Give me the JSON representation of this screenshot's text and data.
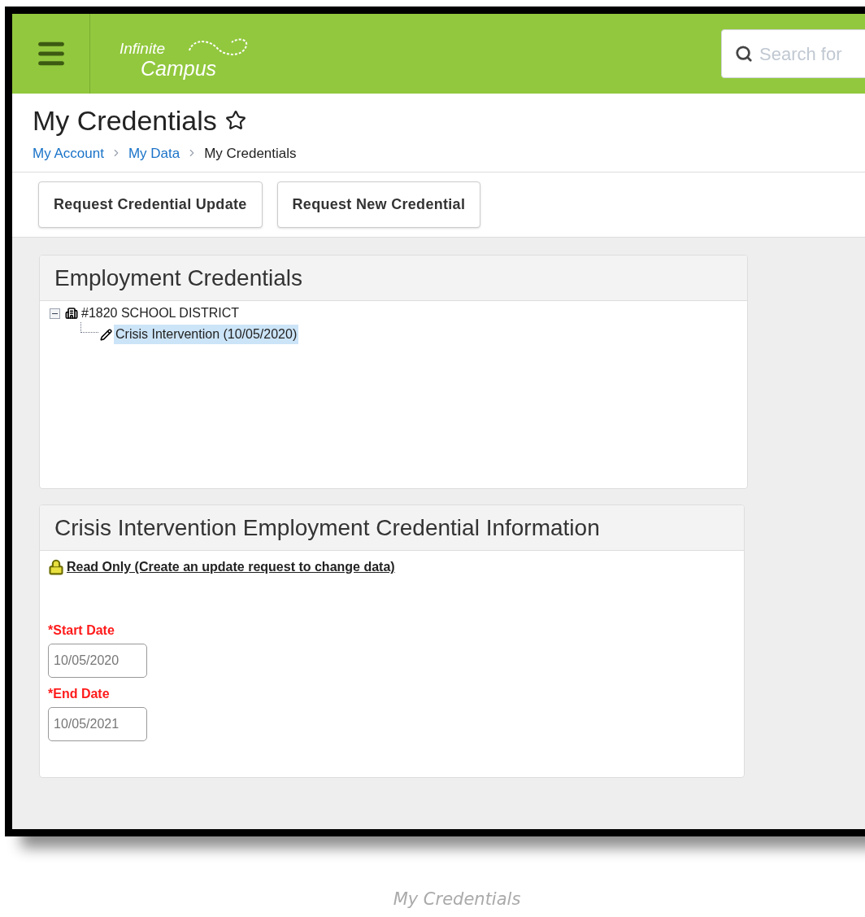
{
  "header": {
    "logo": {
      "line_1": "Infinite",
      "line_2": "Campus"
    },
    "search": {
      "placeholder": "Search for"
    }
  },
  "page": {
    "title": "My Credentials",
    "favorite": false,
    "breadcrumbs": [
      {
        "label": "My Account",
        "current": false
      },
      {
        "label": "My Data",
        "current": false
      },
      {
        "label": "My Credentials",
        "current": true
      }
    ]
  },
  "actions": [
    "Request Credential Update",
    "Request New Credential"
  ],
  "tree_panel": {
    "title": "Employment Credentials",
    "nodes": [
      {
        "label": "#1820 SCHOOL DISTRICT",
        "kind": "district",
        "expanded": true,
        "selected": false,
        "children": [
          {
            "label": "Crisis Intervention (10/05/2020)",
            "kind": "credential",
            "selected": true
          }
        ]
      }
    ]
  },
  "detail_panel": {
    "title": "Crisis Intervention Employment Credential Information",
    "notice": "Read Only (Create an update request to change data)",
    "fields": [
      {
        "label": "*Start Date",
        "value": "10/05/2020"
      },
      {
        "label": "*End Date",
        "value": "10/05/2021"
      }
    ]
  },
  "caption": "My Credentials"
}
